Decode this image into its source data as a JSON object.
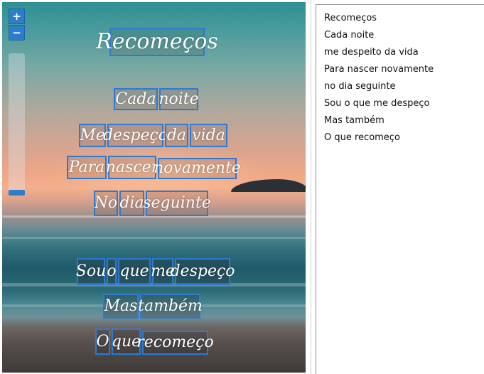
{
  "zoom": {
    "in_label": "+",
    "out_label": "−",
    "level": 0.0
  },
  "image_words": [
    {
      "text": "Recomeços"
    },
    {
      "text": "Cada"
    },
    {
      "text": "noite"
    },
    {
      "text": "Me"
    },
    {
      "text": "despeço"
    },
    {
      "text": "da"
    },
    {
      "text": "vida"
    },
    {
      "text": "Para"
    },
    {
      "text": "nascer"
    },
    {
      "text": "novamente"
    },
    {
      "text": "No"
    },
    {
      "text": "dia"
    },
    {
      "text": "seguinte"
    },
    {
      "text": "Sou"
    },
    {
      "text": "o"
    },
    {
      "text": "que"
    },
    {
      "text": "me"
    },
    {
      "text": "despeço"
    },
    {
      "text": "Mas"
    },
    {
      "text": "também"
    },
    {
      "text": "O"
    },
    {
      "text": "que"
    },
    {
      "text": "recomeço"
    }
  ],
  "transcript": {
    "lines": [
      "Recomeços",
      "Cada noite",
      "me despeito da vida",
      "Para nascer novamente",
      "no dia seguinte",
      "Sou o que me despeço",
      "Mas também",
      "O que recomeço"
    ]
  },
  "colors": {
    "box_border": "#2f79cf",
    "zoom_button": "#2d7ec9"
  }
}
